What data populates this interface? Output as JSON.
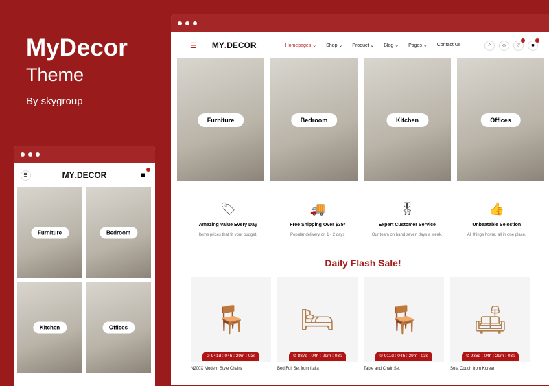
{
  "brand": {
    "title": "MyDecor",
    "subtitle": "Theme",
    "by": "By skygroup"
  },
  "site": {
    "logo_a": "MY",
    "logo_dot": ".",
    "logo_b": "DECOR",
    "menu": [
      "Homepages ⌄",
      "Shop ⌄",
      "Product ⌄",
      "Blog ⌄",
      "Pages ⌄",
      "Contact Us"
    ],
    "categories": [
      "Furniture",
      "Bedroom",
      "Kitchen",
      "Offices"
    ],
    "features": [
      {
        "icon": "tag-icon",
        "glyph": "🏷",
        "title": "Amazing Value Every Day",
        "text": "Items prices that fit your budget."
      },
      {
        "icon": "truck-icon",
        "glyph": "🚚",
        "title": "Free Shipping Over $35*",
        "text": "Popular delivery on 1 - 2 days"
      },
      {
        "icon": "award-icon",
        "glyph": "🎖",
        "title": "Expert Customer Service",
        "text": "Our team on hand seven days a week."
      },
      {
        "icon": "thumbs-up-icon",
        "glyph": "👍",
        "title": "Unbeatable Selection",
        "text": "All things home, all in one place."
      }
    ],
    "flash_title": "Daily Flash Sale!",
    "products": [
      {
        "name": "N200X Modern Style Chairs",
        "timer": "⏱ 941d : 04h : 29m : 03s",
        "glyph": "🪑"
      },
      {
        "name": "Bed Full Set from Italia",
        "timer": "⏱ 887d : 04h : 29m : 03s",
        "glyph": "🛏"
      },
      {
        "name": "Table and Chair Set",
        "timer": "⏱ 911d : 04h : 29m : 03s",
        "glyph": "🪑"
      },
      {
        "name": "Sofa Couch from Korean",
        "timer": "⏱ 936d : 04h : 29m : 03s",
        "glyph": "🛋"
      }
    ]
  }
}
